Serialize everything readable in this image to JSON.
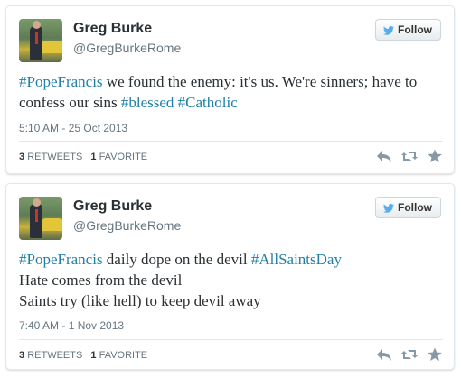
{
  "tweets": [
    {
      "name": "Greg Burke",
      "handle": "@GregBurkeRome",
      "follow_label": "Follow",
      "segments": [
        {
          "text": "#PopeFrancis",
          "hashtag": true
        },
        {
          "text": " we found the enemy: it's us. We're sinners; have to confess our sins ",
          "hashtag": false
        },
        {
          "text": "#blessed",
          "hashtag": true
        },
        {
          "text": " ",
          "hashtag": false
        },
        {
          "text": "#Catholic",
          "hashtag": true
        }
      ],
      "timestamp": "5:10 AM - 25 Oct 2013",
      "retweets_count": "3",
      "retweets_label": "RETWEETS",
      "favorites_count": "1",
      "favorites_label": "FAVORITE"
    },
    {
      "name": "Greg Burke",
      "handle": "@GregBurkeRome",
      "follow_label": "Follow",
      "lines": [
        [
          {
            "text": "#PopeFrancis",
            "hashtag": true
          },
          {
            "text": " daily dope on the devil ",
            "hashtag": false
          },
          {
            "text": "#AllSaintsDay",
            "hashtag": true
          }
        ],
        [
          {
            "text": "Hate comes from the devil",
            "hashtag": false
          }
        ],
        [
          {
            "text": "Saints try (like hell) to keep devil away",
            "hashtag": false
          }
        ]
      ],
      "timestamp": "7:40 AM - 1 Nov 2013",
      "retweets_count": "3",
      "retweets_label": "RETWEETS",
      "favorites_count": "1",
      "favorites_label": "FAVORITE"
    }
  ],
  "colors": {
    "hashtag": "#1f7fa6",
    "icon_gray": "#8899a6",
    "twitter_blue": "#55acee"
  },
  "icons": [
    "twitter-bird-icon",
    "reply-icon",
    "retweet-icon",
    "favorite-star-icon"
  ]
}
